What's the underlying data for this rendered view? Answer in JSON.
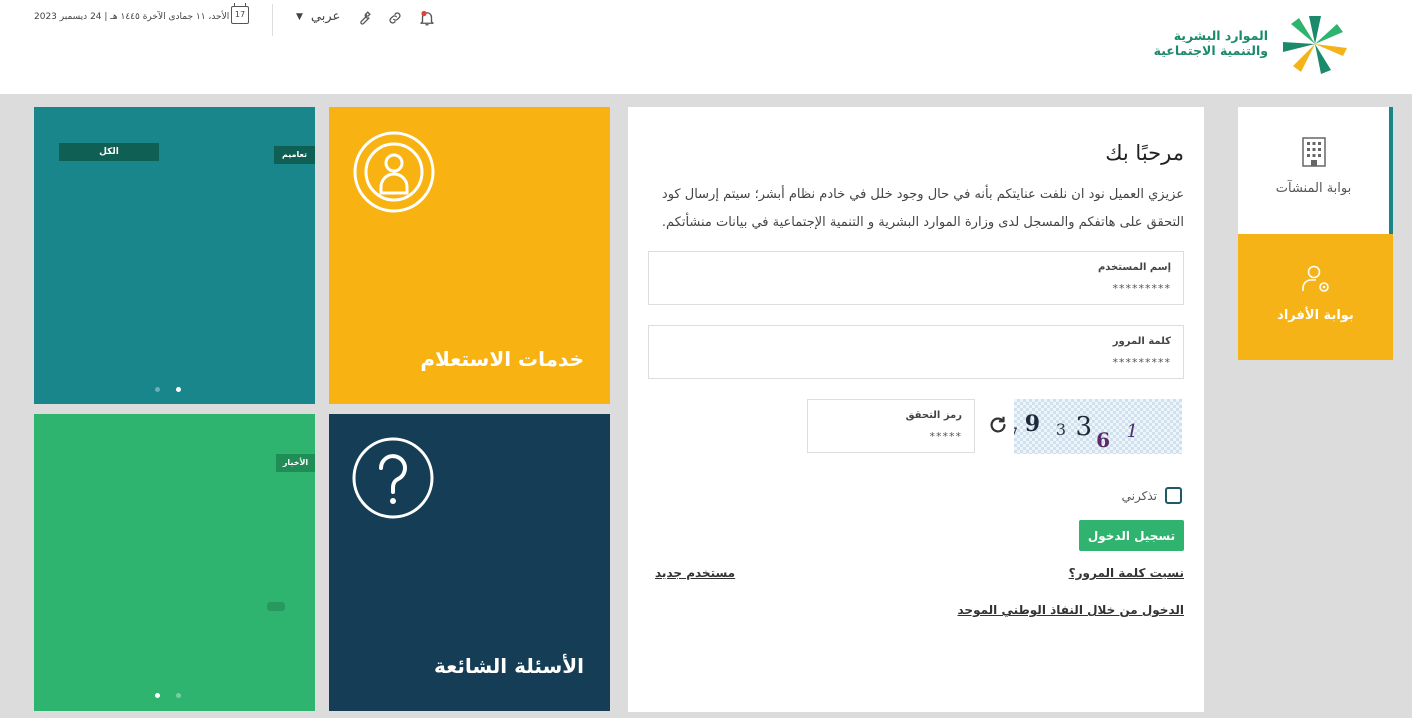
{
  "header": {
    "date_text": "الأحد، ١١ جمادى الآخرة ١٤٤٥ هـ | 24 ديسمبر 2023",
    "calendar_day": "17",
    "language": "عربي",
    "logo_line1": "الموارد البشرية",
    "logo_line2": "والتنمية الاجتماعية",
    "icons": [
      "calendar-icon",
      "chevron-down-icon",
      "wrench-icon",
      "link-icon",
      "bell-icon"
    ]
  },
  "sidebar": {
    "items": [
      {
        "label": "بوابة المنشآت",
        "icon": "building-icon",
        "active": true
      },
      {
        "label": "بوابة الأفراد",
        "icon": "user-gear-icon",
        "active": false
      }
    ]
  },
  "login": {
    "welcome": "مرحبًا بك",
    "intro": "عزيزي العميل نود ان نلفت عنايتكم بأنه في حال وجود خلل في خادم نظام أبشر؛ سيتم إرسال كود التحقق على هاتفكم والمسجل لدى وزارة الموارد البشرية و التنمية الإجتماعية في بيانات منشأتكم.",
    "username_label": "إسم المستخدم",
    "username_value": "*********",
    "password_label": "كلمة المرور",
    "password_value": "*********",
    "captcha_label": "رمز التحقق",
    "captcha_value": "*****",
    "captcha_chars": [
      "7",
      "9",
      "3",
      "3",
      "6",
      "1"
    ],
    "remember_label": "تذكرني",
    "login_button": "تسجيل الدخول",
    "forgot_password": "نسيت كلمة المرور؟",
    "new_user": "مستخدم جديد",
    "nafath_login": "الدخول من خلال النفاذ الوطني الموحد"
  },
  "tiles": {
    "announcements_tag": "الكل",
    "announcements_tag2": "تعاميم",
    "inquiry_title": "خدمات الاستعلام",
    "news_tag": "الأخبار",
    "faq_title": "الأسئلة الشائعة"
  },
  "colors": {
    "teal": "#18868b",
    "yellow": "#f8b313",
    "green": "#2fb46f",
    "navy": "#153d56",
    "button_green": "#2fb36e",
    "brand_green": "#1b8a6b"
  }
}
